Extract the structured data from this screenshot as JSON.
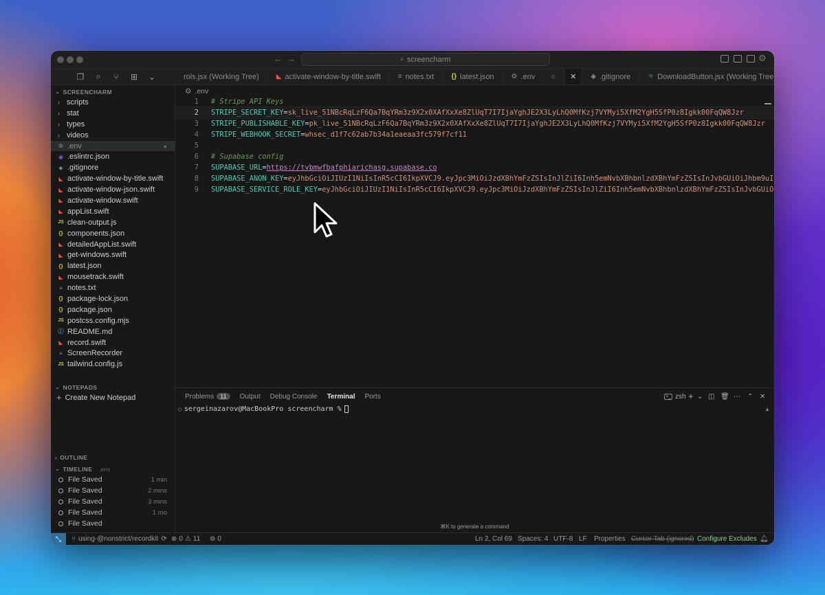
{
  "window": {
    "title": "screencharm",
    "search_icon": "search-icon"
  },
  "tabs": [
    {
      "label": "rols.jsx (Working Tree)",
      "icon": "react-icon"
    },
    {
      "label": "activate-window-by-title.swift",
      "icon": "swift-icon"
    },
    {
      "label": "notes.txt",
      "icon": "text-icon"
    },
    {
      "label": "latest.json",
      "icon": "json-icon"
    },
    {
      "label": ".env",
      "icon": "gear-icon",
      "active": true
    },
    {
      "label": ".gitignore",
      "icon": "git-icon"
    },
    {
      "label": "DownloadButton.jsx (Working Tree)",
      "icon": "react-icon"
    }
  ],
  "sidebar": {
    "explorer_title": "SCREENCHARM",
    "items": [
      {
        "label": "scripts",
        "type": "folder"
      },
      {
        "label": "stat",
        "type": "folder"
      },
      {
        "label": "types",
        "type": "folder"
      },
      {
        "label": "videos",
        "type": "folder"
      },
      {
        "label": ".env",
        "type": "gear",
        "selected": true
      },
      {
        "label": ".eslintrc.json",
        "type": "eslint"
      },
      {
        "label": ".gitignore",
        "type": "git"
      },
      {
        "label": "activate-window-by-title.swift",
        "type": "swift"
      },
      {
        "label": "activate-window-json.swift",
        "type": "swift"
      },
      {
        "label": "activate-window.swift",
        "type": "swift"
      },
      {
        "label": "appList.swift",
        "type": "swift"
      },
      {
        "label": "clean-output.js",
        "type": "js"
      },
      {
        "label": "components.json",
        "type": "json"
      },
      {
        "label": "detailedAppList.swift",
        "type": "swift"
      },
      {
        "label": "get-windows.swift",
        "type": "swift"
      },
      {
        "label": "latest.json",
        "type": "json"
      },
      {
        "label": "mousetrack.swift",
        "type": "swift"
      },
      {
        "label": "notes.txt",
        "type": "txt"
      },
      {
        "label": "package-lock.json",
        "type": "json"
      },
      {
        "label": "package.json",
        "type": "json"
      },
      {
        "label": "postcss.config.mjs",
        "type": "js"
      },
      {
        "label": "README.md",
        "type": "md"
      },
      {
        "label": "record.swift",
        "type": "swift"
      },
      {
        "label": "ScreenRecorder",
        "type": "txt"
      },
      {
        "label": "tailwind.config.js",
        "type": "js"
      }
    ],
    "notepads_title": "NOTEPADS",
    "create_notepad": "Create New Notepad",
    "outline_title": "OUTLINE",
    "timeline_title": "TIMELINE",
    "timeline_file": ".env",
    "timeline": [
      {
        "label": "File Saved",
        "when": "1 min"
      },
      {
        "label": "File Saved",
        "when": "2 mins"
      },
      {
        "label": "File Saved",
        "when": "3 mins"
      },
      {
        "label": "File Saved",
        "when": "1 mo"
      },
      {
        "label": "File Saved",
        "when": ""
      }
    ]
  },
  "editor": {
    "breadcrumb": ".env",
    "lines": [
      {
        "n": "1",
        "comment": "# Stripe API Keys"
      },
      {
        "n": "2",
        "key": "STRIPE_SECRET_KEY",
        "value": "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",
        "current": true
      },
      {
        "n": "3",
        "key": "STRIPE_PUBLISHABLE_KEY",
        "value": "pk_live_51NBcRqLzF6Qa7BqYRm3z9X2x0XAfXxXe8ZlUqT7I7IjaYghJE2X3LyLhQ0MfKzj7VYMyi5XfM2YgH5SfP0z8Igkk00FqQW8Jzr"
      },
      {
        "n": "4",
        "key": "STRIPE_WEBHOOK_SECRET",
        "value": "whsec_d1f7c62ab7b34a1eaeaa3fc579f7cf11"
      },
      {
        "n": "5"
      },
      {
        "n": "6",
        "comment": "# Supabase config"
      },
      {
        "n": "7",
        "key": "SUPABASE_URL",
        "value": "https://tvbmwfbafphiarichasg.supabase.co",
        "is_url": true
      },
      {
        "n": "8",
        "key": "SUPABASE_ANON_KEY",
        "value": "eyJhbGciOiJIUzI1NiIsInR5cCI6IkpXVCJ9.eyJpc3MiOiJzdXBhYmFzZSIsInJlZiI6Inh5emNvbXBhbnlzdXBhYmFzZSIsInJvbGUiOiJhbm9uIiwi"
      },
      {
        "n": "9",
        "key": "SUPABASE_SERVICE_ROLE_KEY",
        "value": "eyJhbGciOiJIUzI1NiIsInR5cCI6IkpXVCJ9.eyJpc3MiOiJzdXBhYmFzZSIsInJlZiI6Inh5emNvbXBhbnlzdXBhYmFzZSIsInJvbGUiOiJz"
      }
    ]
  },
  "panel": {
    "tabs": [
      "Problems",
      "Output",
      "Debug Console",
      "Terminal",
      "Ports"
    ],
    "problems_count": "11",
    "active_tab": "Terminal",
    "shell": "zsh",
    "prompt": "sergeinazarov@MacBookPro screencharm %",
    "generate_hint": "⌘K to generate a command"
  },
  "status": {
    "branch": "using-@nonstrict/recordkit",
    "errors": "0",
    "warnings": "11",
    "ports": "0",
    "position": "Ln 2, Col 69",
    "spaces": "Spaces: 4",
    "encoding": "UTF-8",
    "eol": "LF",
    "properties": "Properties",
    "cursor_tab": "Cursor Tab (ignored)",
    "configure": "Configure Excludes"
  },
  "colors": {
    "key": "#4ec9b0",
    "value": "#ce9178",
    "url": "#c586c0",
    "comment": "#6a9955",
    "configure": "#89d185"
  }
}
